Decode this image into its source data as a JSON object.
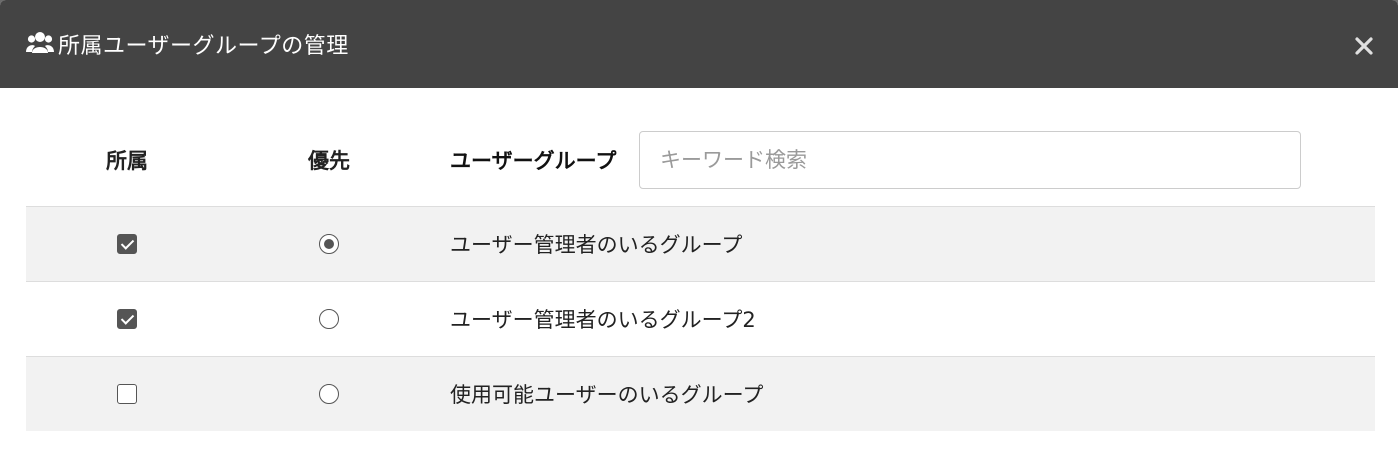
{
  "modal": {
    "title": "所属ユーザーグループの管理",
    "header_icon": "users-icon",
    "close_icon": "close-icon"
  },
  "table": {
    "headers": {
      "belong": "所属",
      "priority": "優先",
      "group": "ユーザーグループ"
    },
    "search": {
      "placeholder": "キーワード検索",
      "value": ""
    },
    "rows": [
      {
        "belong": true,
        "priority": true,
        "name": "ユーザー管理者のいるグループ"
      },
      {
        "belong": true,
        "priority": false,
        "name": "ユーザー管理者のいるグループ2"
      },
      {
        "belong": false,
        "priority": false,
        "name": "使用可能ユーザーのいるグループ"
      }
    ]
  },
  "colors": {
    "header_bg": "#444444",
    "stripe_bg": "#f2f2f2",
    "control": "#555555"
  }
}
